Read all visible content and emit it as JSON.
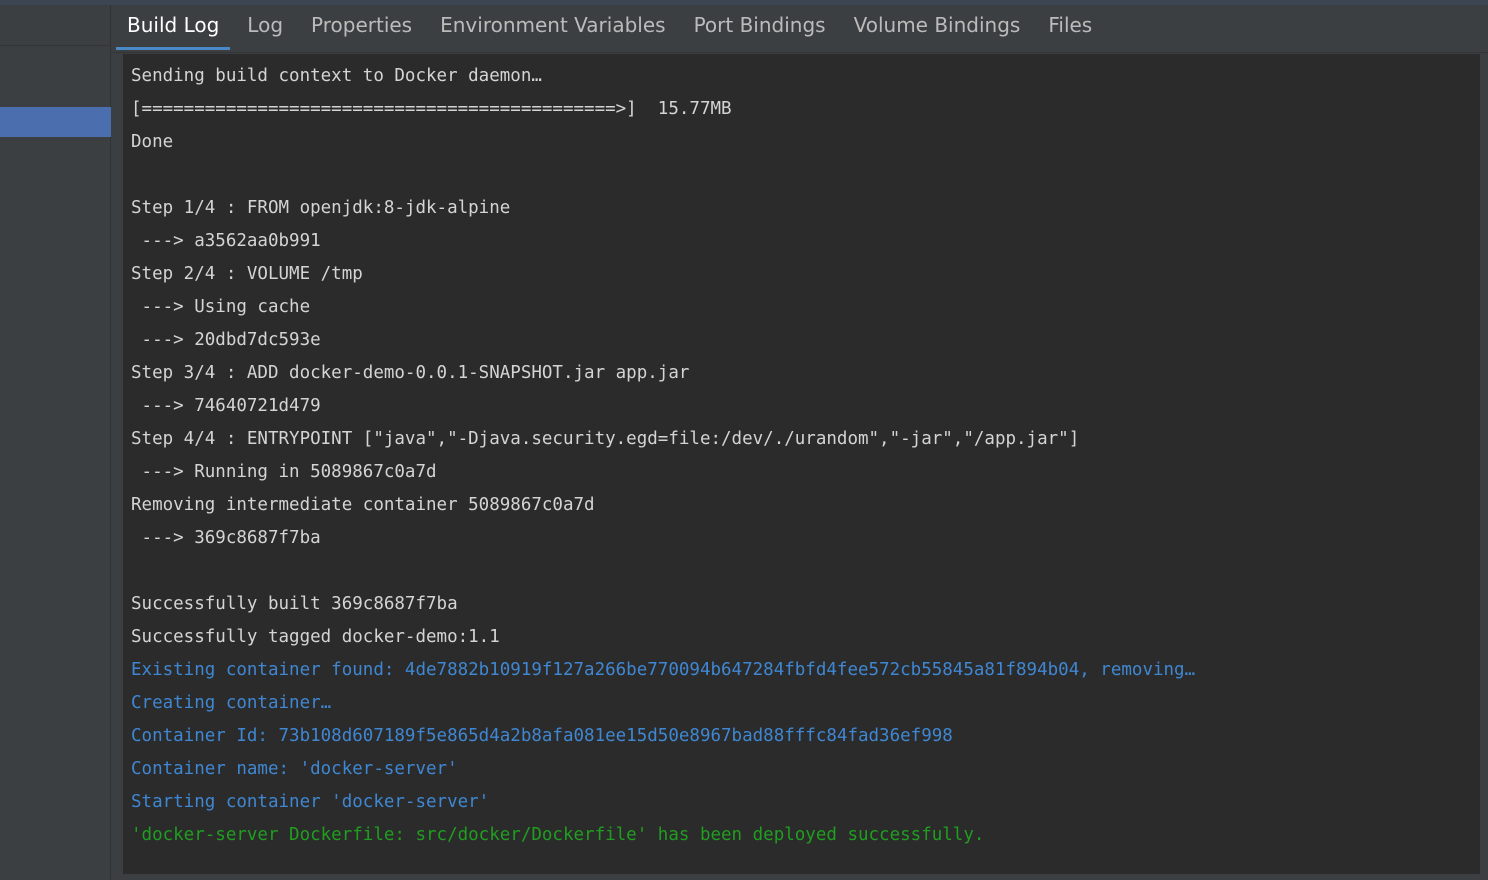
{
  "window": {
    "accent_strip_color": "#3c4552"
  },
  "sidebar": {
    "selected_row_color": "#4b6eaf",
    "items": [
      {
        "label": ""
      },
      {
        "label": ""
      }
    ]
  },
  "tabs": {
    "active_index": 0,
    "active_underline_color": "#4a88c7",
    "items": [
      {
        "label": "Build Log",
        "active": true
      },
      {
        "label": "Log",
        "active": false
      },
      {
        "label": "Properties",
        "active": false
      },
      {
        "label": "Environment Variables",
        "active": false
      },
      {
        "label": "Port Bindings",
        "active": false
      },
      {
        "label": "Volume Bindings",
        "active": false
      },
      {
        "label": "Files",
        "active": false
      }
    ]
  },
  "console": {
    "background_color": "#2b2b2b",
    "default_text_color": "#d4d4d4",
    "info_text_color": "#3f87d2",
    "success_text_color": "#1f9e1f",
    "lines": [
      {
        "text": "Sending build context to Docker daemon…",
        "color": "default"
      },
      {
        "text": "[=============================================>]  15.77MB",
        "color": "default"
      },
      {
        "text": "Done",
        "color": "default"
      },
      {
        "text": "",
        "color": "default"
      },
      {
        "text": "Step 1/4 : FROM openjdk:8-jdk-alpine",
        "color": "default"
      },
      {
        "text": " ---> a3562aa0b991",
        "color": "default"
      },
      {
        "text": "Step 2/4 : VOLUME /tmp",
        "color": "default"
      },
      {
        "text": " ---> Using cache",
        "color": "default"
      },
      {
        "text": " ---> 20dbd7dc593e",
        "color": "default"
      },
      {
        "text": "Step 3/4 : ADD docker-demo-0.0.1-SNAPSHOT.jar app.jar",
        "color": "default"
      },
      {
        "text": " ---> 74640721d479",
        "color": "default"
      },
      {
        "text": "Step 4/4 : ENTRYPOINT [\"java\",\"-Djava.security.egd=file:/dev/./urandom\",\"-jar\",\"/app.jar\"]",
        "color": "default"
      },
      {
        "text": " ---> Running in 5089867c0a7d",
        "color": "default"
      },
      {
        "text": "Removing intermediate container 5089867c0a7d",
        "color": "default"
      },
      {
        "text": " ---> 369c8687f7ba",
        "color": "default"
      },
      {
        "text": "",
        "color": "default"
      },
      {
        "text": "Successfully built 369c8687f7ba",
        "color": "default"
      },
      {
        "text": "Successfully tagged docker-demo:1.1",
        "color": "default"
      },
      {
        "text": "Existing container found: 4de7882b10919f127a266be770094b647284fbfd4fee572cb55845a81f894b04, removing…",
        "color": "blue"
      },
      {
        "text": "Creating container…",
        "color": "blue"
      },
      {
        "text": "Container Id: 73b108d607189f5e865d4a2b8afa081ee15d50e8967bad88fffc84fad36ef998",
        "color": "blue"
      },
      {
        "text": "Container name: 'docker-server'",
        "color": "blue"
      },
      {
        "text": "Starting container 'docker-server'",
        "color": "blue"
      },
      {
        "text": "'docker-server Dockerfile: src/docker/Dockerfile' has been deployed successfully.",
        "color": "green"
      }
    ]
  }
}
